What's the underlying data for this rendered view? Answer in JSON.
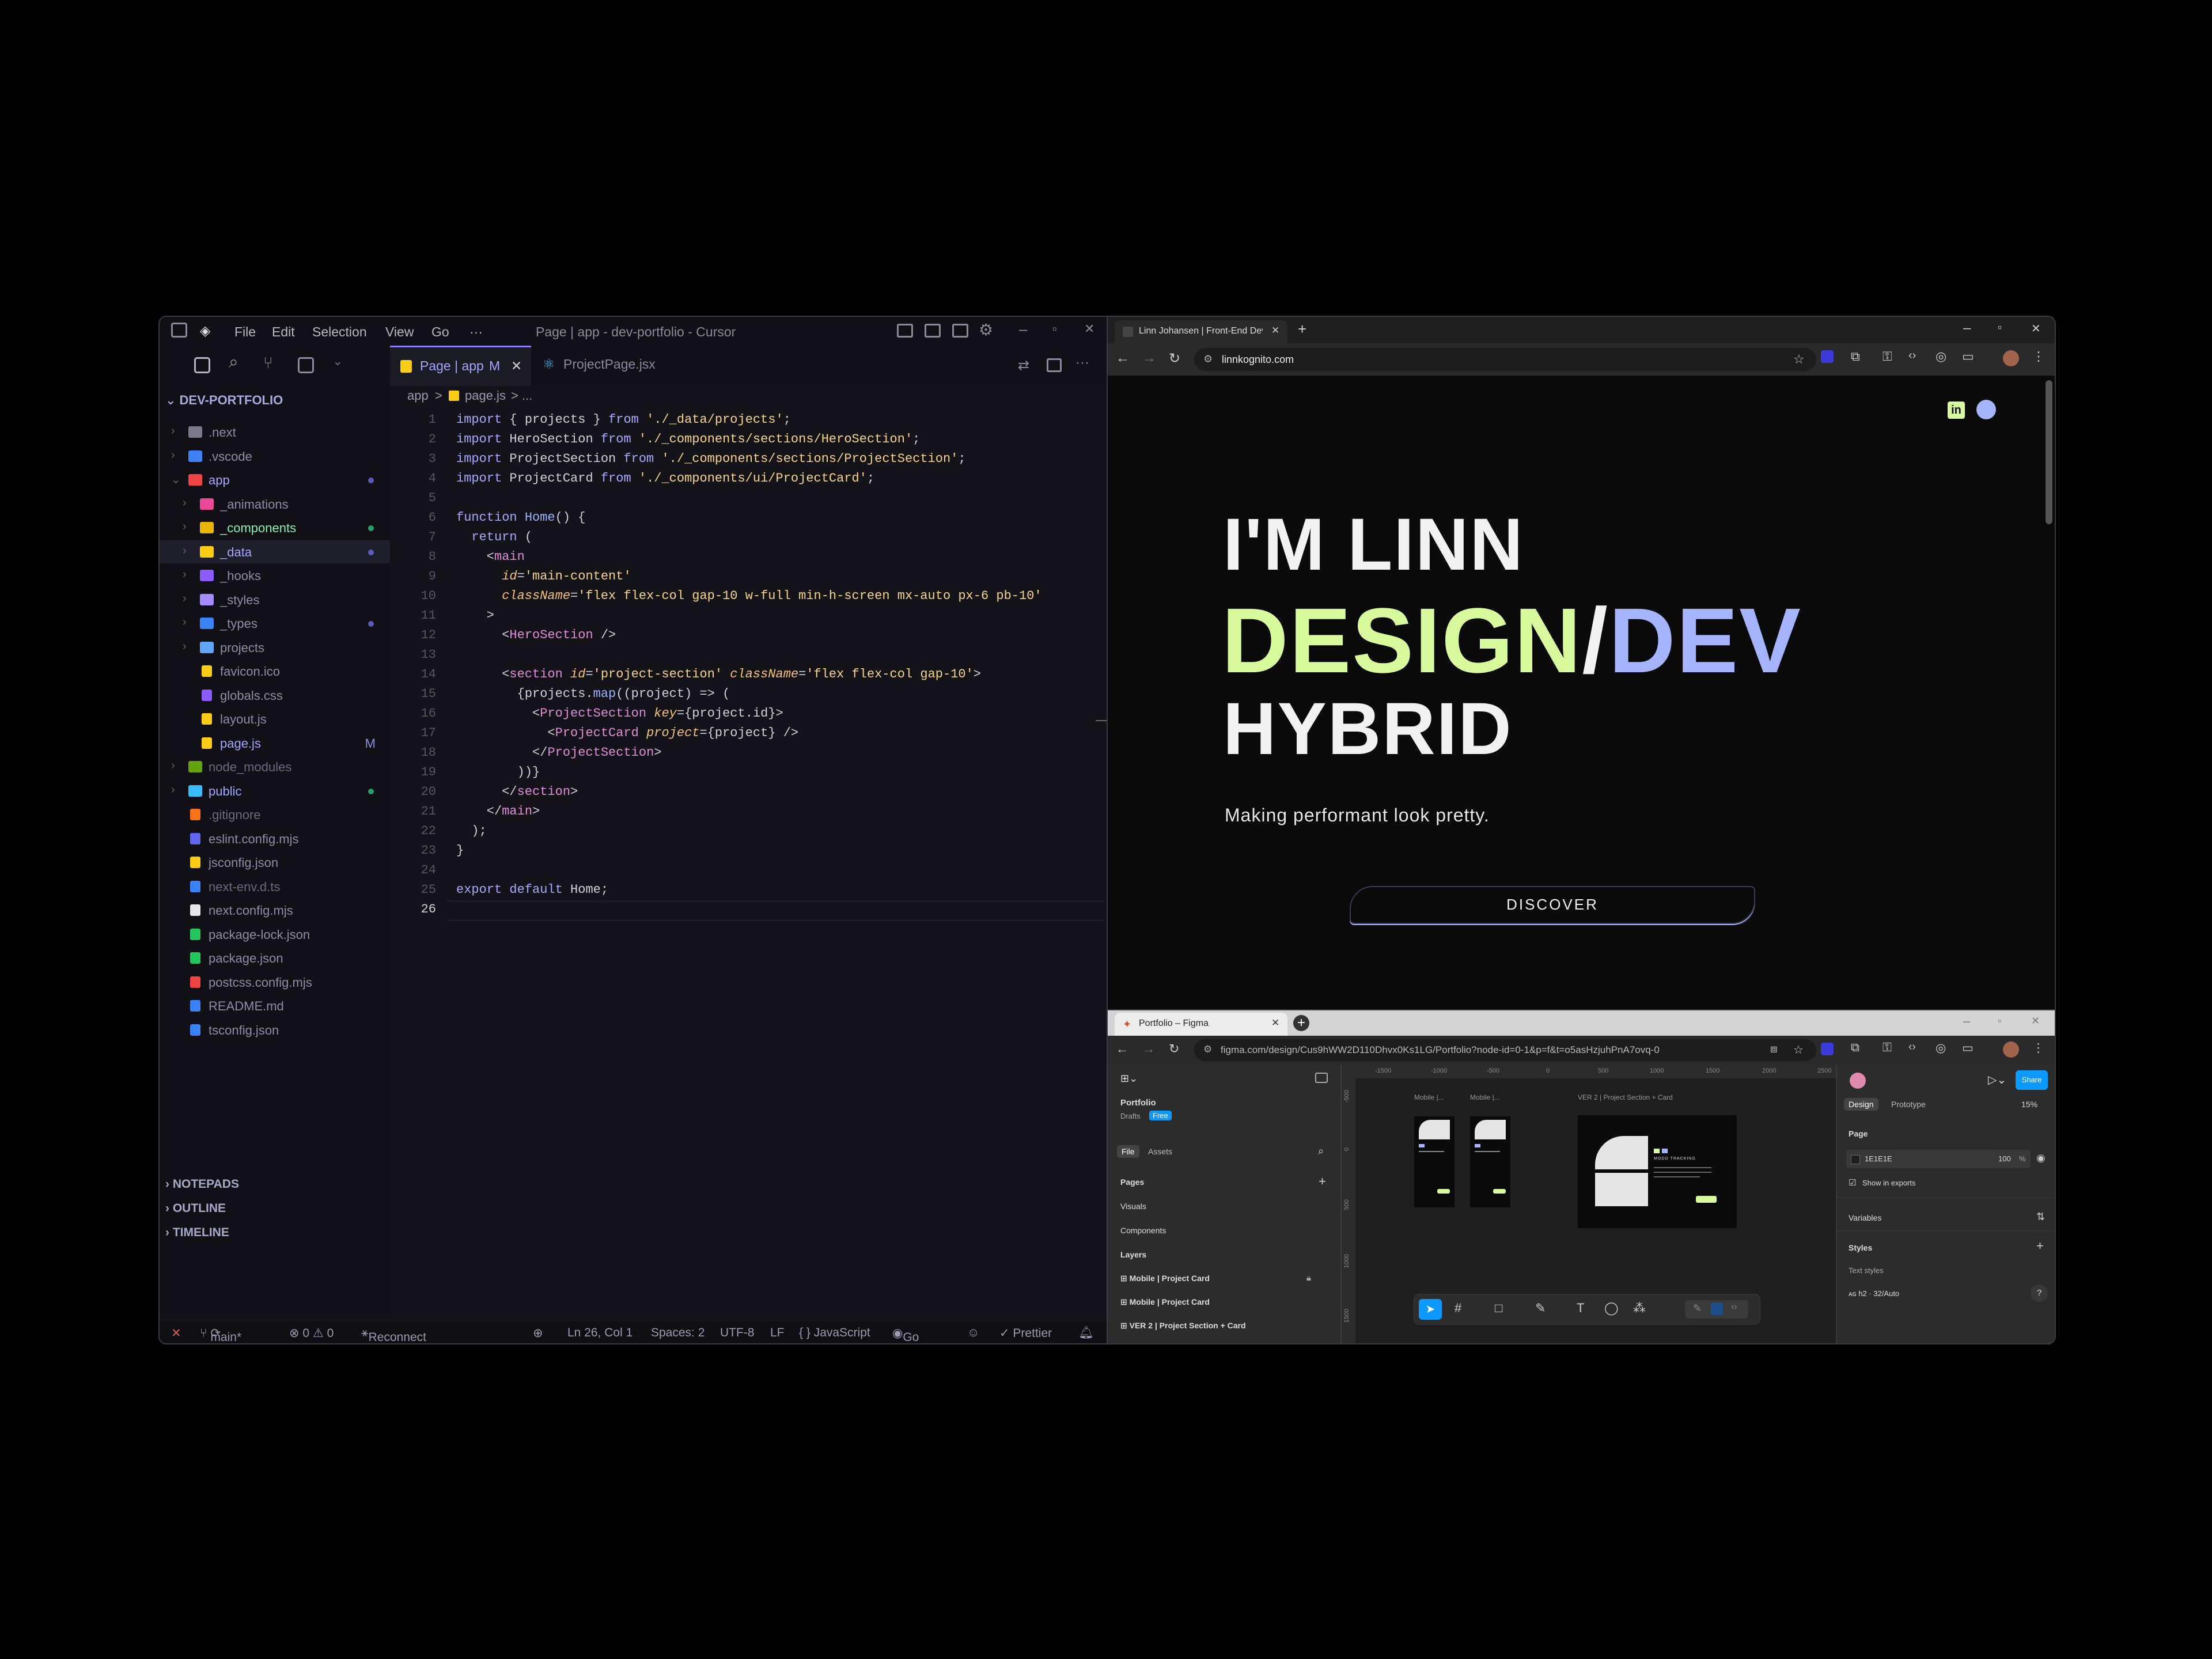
{
  "editor": {
    "menu": [
      "File",
      "Edit",
      "Selection",
      "View",
      "Go",
      "···"
    ],
    "window_title": "Page | app - dev-portfolio - Cursor",
    "tabs": [
      {
        "label": "Page | app",
        "badge": "M",
        "close": "✕"
      },
      {
        "label": "ProjectPage.jsx"
      }
    ],
    "breadcrumb": [
      "app",
      ">",
      "page.js",
      "> ..."
    ],
    "explorer_root": "DEV-PORTFOLIO",
    "tree": [
      {
        "label": ".next",
        "depth": 1,
        "type": "folder",
        "color": "#7a7a8c"
      },
      {
        "label": ".vscode",
        "depth": 1,
        "type": "folder",
        "color": "#3b82f6"
      },
      {
        "label": "app",
        "depth": 1,
        "type": "folder-open",
        "color": "#ef4444"
      },
      {
        "label": "_animations",
        "depth": 2,
        "type": "folder",
        "color": "#ec4899"
      },
      {
        "label": "_components",
        "depth": 2,
        "type": "folder",
        "color": "#eab308"
      },
      {
        "label": "_data",
        "depth": 2,
        "type": "folder",
        "color": "#facc15"
      },
      {
        "label": "_hooks",
        "depth": 2,
        "type": "folder",
        "color": "#8b5cf6"
      },
      {
        "label": "_styles",
        "depth": 2,
        "type": "folder",
        "color": "#a78bfa"
      },
      {
        "label": "_types",
        "depth": 2,
        "type": "folder",
        "color": "#3b82f6"
      },
      {
        "label": "projects",
        "depth": 2,
        "type": "folder",
        "color": "#60a5fa"
      },
      {
        "label": "favicon.ico",
        "depth": 2,
        "type": "file",
        "color": "#facc15"
      },
      {
        "label": "globals.css",
        "depth": 2,
        "type": "file",
        "color": "#8b5cf6"
      },
      {
        "label": "layout.js",
        "depth": 2,
        "type": "file",
        "color": "#facc15"
      },
      {
        "label": "page.js",
        "depth": 2,
        "type": "file",
        "color": "#facc15"
      },
      {
        "label": "node_modules",
        "depth": 1,
        "type": "folder",
        "color": "#65a30d"
      },
      {
        "label": "public",
        "depth": 1,
        "type": "folder",
        "color": "#38bdf8"
      },
      {
        "label": ".gitignore",
        "depth": 1,
        "type": "file",
        "color": "#f97316"
      },
      {
        "label": "eslint.config.mjs",
        "depth": 1,
        "type": "file",
        "color": "#6366f1"
      },
      {
        "label": "jsconfig.json",
        "depth": 1,
        "type": "file",
        "color": "#facc15"
      },
      {
        "label": "next-env.d.ts",
        "depth": 1,
        "type": "file",
        "color": "#3b82f6"
      },
      {
        "label": "next.config.mjs",
        "depth": 1,
        "type": "file",
        "color": "#e5e7eb"
      },
      {
        "label": "package-lock.json",
        "depth": 1,
        "type": "file",
        "color": "#22c55e"
      },
      {
        "label": "package.json",
        "depth": 1,
        "type": "file",
        "color": "#22c55e"
      },
      {
        "label": "postcss.config.mjs",
        "depth": 1,
        "type": "file",
        "color": "#ef4444"
      },
      {
        "label": "README.md",
        "depth": 1,
        "type": "file",
        "color": "#3b82f6"
      },
      {
        "label": "tsconfig.json",
        "depth": 1,
        "type": "file",
        "color": "#3b82f6"
      }
    ],
    "panels": [
      "NOTEPADS",
      "OUTLINE",
      "TIMELINE"
    ],
    "status": {
      "branch": "main*",
      "problems": "⊗ 0 ⚠ 0",
      "discord": "Reconnect to Discord",
      "cursor": "Ln 26, Col 1",
      "spaces": "Spaces: 2",
      "encoding": "UTF-8",
      "eol": "LF",
      "language": "{ } JavaScript",
      "golive": "Go Live",
      "prettier": "✓ Prettier"
    },
    "code": [
      "import { projects } from './_data/projects';",
      "import HeroSection from './_components/sections/HeroSection';",
      "import ProjectSection from './_components/sections/ProjectSection';",
      "import ProjectCard from './_components/ui/ProjectCard';",
      "",
      "function Home() {",
      "  return (",
      "    <main",
      "      id='main-content'",
      "      className='flex flex-col gap-10 w-full min-h-screen mx-auto px-6 pb-10'",
      "    >",
      "      <HeroSection />",
      "",
      "      <section id='project-section' className='flex flex-col gap-10'>",
      "        {projects.map((project) => (",
      "          <ProjectSection key={project.id}>",
      "            <ProjectCard project={project} />",
      "          </ProjectSection>",
      "        ))}",
      "      </section>",
      "    </main>",
      "  );",
      "}",
      "",
      "export default Home;",
      ""
    ]
  },
  "browser": {
    "tab_title": "Linn Johansen | Front-End Devel",
    "url": "linnkognito.com",
    "hero": {
      "line1": "I'M LINN",
      "design": "DESIGN",
      "slash": "/",
      "dev": "DEV",
      "line3": "HYBRID",
      "tagline": "Making performant look pretty.",
      "cta": "DISCOVER"
    },
    "colors": {
      "design": "#d9f99d",
      "dev": "#a5b4fc",
      "accent": "#a5b4fc"
    }
  },
  "figma": {
    "tab_title": "Portfolio – Figma",
    "url": "figma.com/design/Cus9hWW2D110Dhvx0Ks1LG/Portfolio?node-id=0-1&p=f&t=o5asHzjuhPnA7ovq-0",
    "file_name": "Portfolio",
    "drafts": "Drafts",
    "plan": "Free",
    "left_tabs": [
      "File",
      "Assets"
    ],
    "pages_heading": "Pages",
    "pages": [
      "Visuals",
      "Components"
    ],
    "layers_heading": "Layers",
    "layers": [
      "Mobile | Project Card",
      "Mobile | Project Card",
      "VER 2 | Project Section + Card"
    ],
    "ruler": [
      "-1500",
      "-1000",
      "-500",
      "0",
      "500",
      "1000",
      "1500",
      "2000",
      "2500"
    ],
    "ruler_v": [
      "-500",
      "0",
      "500",
      "1000",
      "1500"
    ],
    "frames": [
      {
        "label": "Mobile |...",
        "thumb_text": "",
        "thumb_line": ""
      },
      {
        "label": "Mobile |...",
        "thumb_text": "",
        "thumb_line": ""
      },
      {
        "label": "VER 2 | Project Section + Card",
        "thumb_text": "MOOD TRACKING",
        "thumb_line": ""
      }
    ],
    "share": "Share",
    "right_tabs": [
      "Design",
      "Prototype"
    ],
    "zoom": "15%",
    "page_section": "Page",
    "page_color": "1E1E1E",
    "opacity": "100",
    "opacity_unit": "%",
    "show_exports": "Show in exports",
    "variables": "Variables",
    "styles": "Styles",
    "text_styles": "Text styles",
    "style_item": "h2 · 32/Auto",
    "help": "?"
  }
}
